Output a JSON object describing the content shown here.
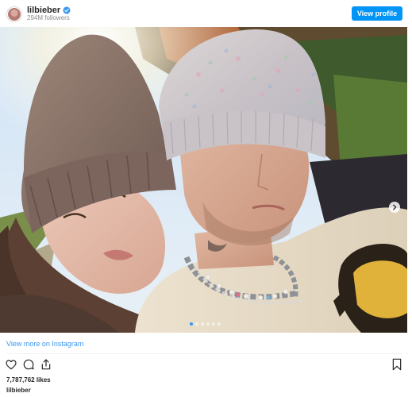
{
  "post": {
    "username": "lilbieber",
    "followers": "294M followers",
    "view_profile_label": "View profile",
    "view_more_label": "View more on Instagram",
    "likes": "7,787,762 likes",
    "caption_user": "lilbieber",
    "carousel": {
      "slides": 6,
      "active_index": 0
    }
  },
  "icons": {
    "verified": "verified-badge-icon",
    "next": "chevron-right-icon",
    "like": "heart-icon",
    "comment": "comment-icon",
    "share": "share-icon",
    "save": "bookmark-icon"
  },
  "colors": {
    "accent": "#0095f6",
    "link": "#3897f0",
    "text": "#262626",
    "muted": "#8e8e8e"
  }
}
